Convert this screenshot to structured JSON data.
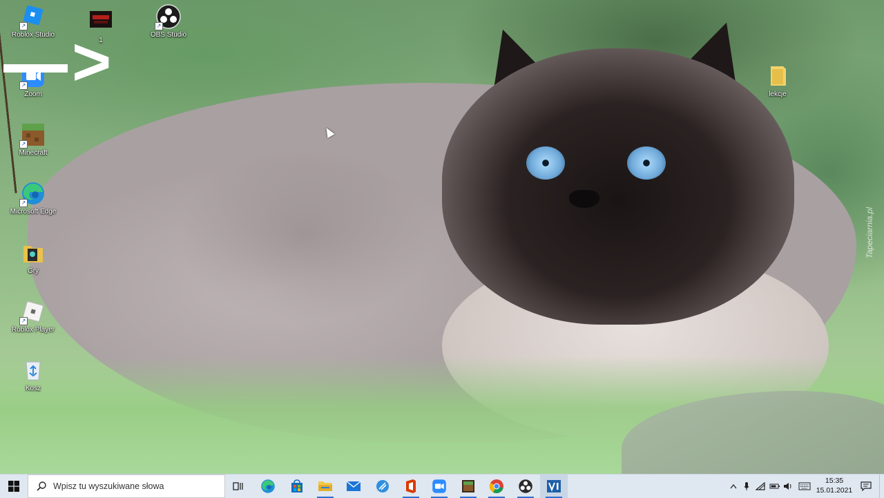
{
  "desktop": {
    "icons": [
      {
        "label": "Roblox Studio"
      },
      {
        "label": "1"
      },
      {
        "label": "OBS Studio"
      },
      {
        "label": "Zoom"
      },
      {
        "label": "Minecraft"
      },
      {
        "label": "Microsoft Edge"
      },
      {
        "label": "Gry"
      },
      {
        "label": "Roblox Player"
      },
      {
        "label": "Kosz"
      },
      {
        "label": "lekcje"
      }
    ],
    "overlay_arrow": ">",
    "watermark": "Tapeciarnia.pl"
  },
  "taskbar": {
    "search_placeholder": "Wpisz tu wyszukiwane słowa",
    "apps": [
      {
        "icon": "task-view-icon"
      },
      {
        "icon": "edge-icon"
      },
      {
        "icon": "store-icon"
      },
      {
        "icon": "file-explorer-icon"
      },
      {
        "icon": "mail-icon"
      },
      {
        "icon": "browser-icon"
      },
      {
        "icon": "office-icon"
      },
      {
        "icon": "zoom-icon"
      },
      {
        "icon": "minecraft-icon"
      },
      {
        "icon": "chrome-icon"
      },
      {
        "icon": "obs-icon"
      },
      {
        "icon": "video-editor-icon"
      }
    ],
    "tray": {
      "time": "15:35",
      "date": "15.01.2021"
    }
  },
  "colors": {
    "taskbar_bg": "#dfe7f0",
    "accent": "#2c6fd1"
  }
}
